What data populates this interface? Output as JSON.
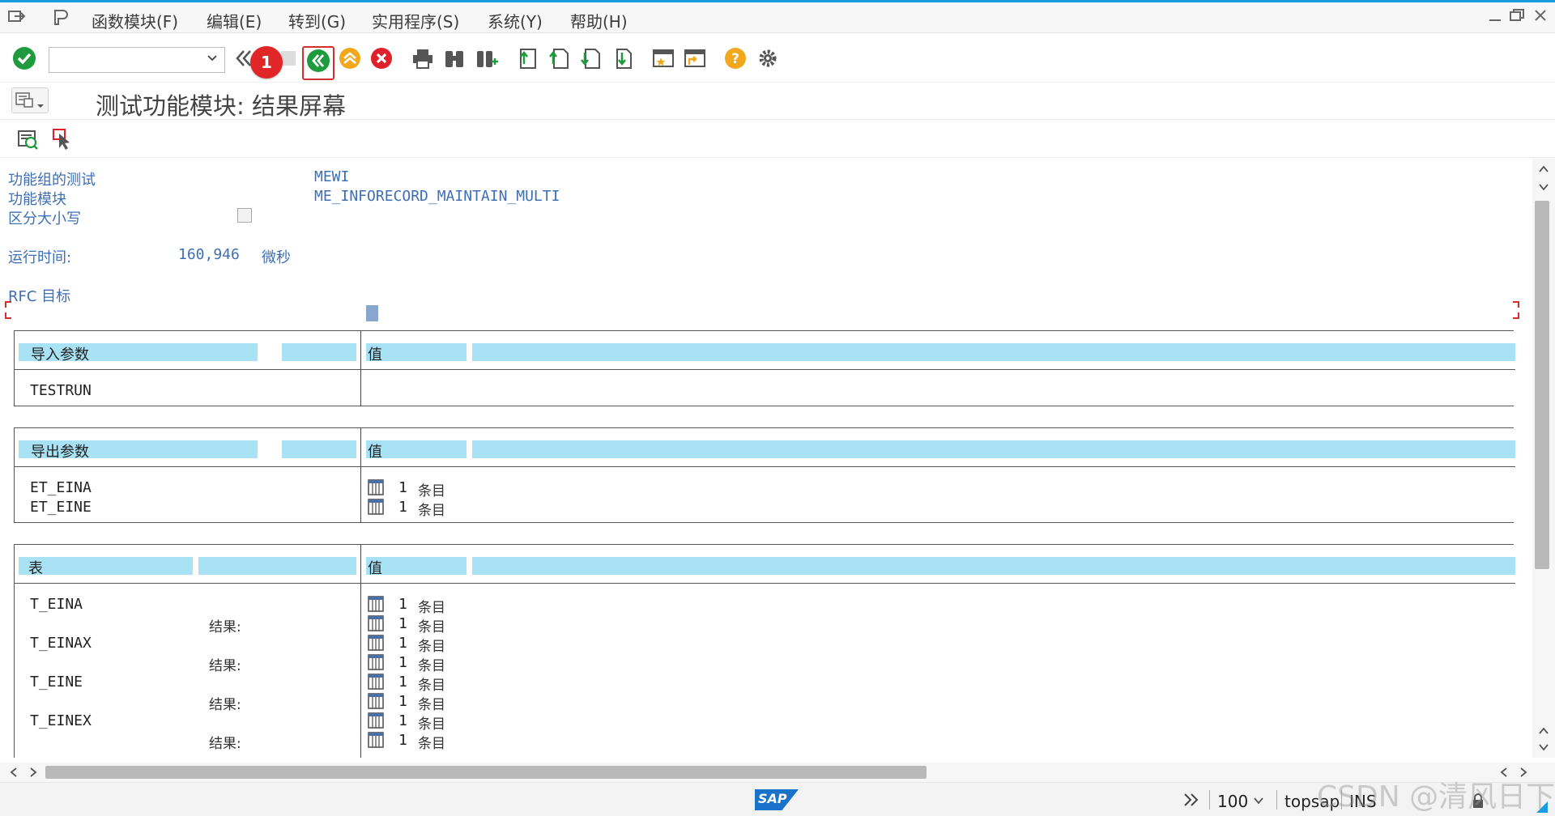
{
  "menu": {
    "items": [
      "函数模块(F)",
      "编辑(E)",
      "转到(G)",
      "实用程序(S)",
      "系统(Y)",
      "帮助(H)"
    ]
  },
  "toolbar": {
    "command_field_value": "",
    "badge_number": "1"
  },
  "title": "测试功能模块: 结果屏幕",
  "fields": {
    "function_group_label": "功能组的测试",
    "function_group_value": "MEWI",
    "function_module_label": "功能模块",
    "function_module_value": "ME_INFORECORD_MAINTAIN_MULTI",
    "case_sensitive_label": "区分大小写",
    "runtime_label": "运行时间:",
    "runtime_value": "160,946",
    "runtime_unit": "微秒",
    "rfc_target_label": "RFC 目标"
  },
  "import_section": {
    "header": "导入参数",
    "value_header": "值",
    "rows": [
      {
        "name": "TESTRUN",
        "value": ""
      }
    ]
  },
  "export_section": {
    "header": "导出参数",
    "value_header": "值",
    "rows": [
      {
        "name": "ET_EINA",
        "count": "1",
        "unit": "条目"
      },
      {
        "name": "ET_EINE",
        "count": "1",
        "unit": "条目"
      }
    ]
  },
  "tables_section": {
    "header": "表",
    "value_header": "值",
    "result_label": "结果:",
    "rows": [
      {
        "name": "T_EINA",
        "count": "1",
        "unit": "条目",
        "result_count": "1",
        "result_unit": "条目"
      },
      {
        "name": "T_EINAX",
        "count": "1",
        "unit": "条目",
        "result_count": "1",
        "result_unit": "条目"
      },
      {
        "name": "T_EINE",
        "count": "1",
        "unit": "条目",
        "result_count": "1",
        "result_unit": "条目"
      },
      {
        "name": "T_EINEX",
        "count": "1",
        "unit": "条目",
        "result_count": "1",
        "result_unit": "条目"
      }
    ]
  },
  "status": {
    "logo": "SAP",
    "zoom": "100",
    "system": "topsap",
    "mode": "INS"
  },
  "watermark": "CSDN @清风日下"
}
